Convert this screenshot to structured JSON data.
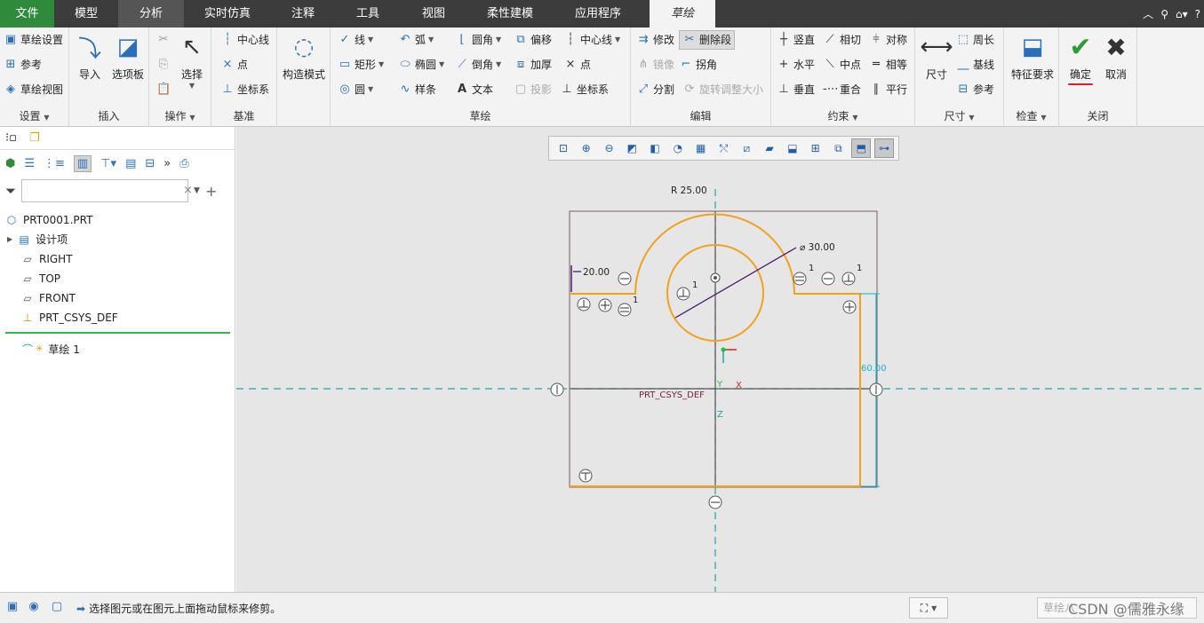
{
  "menu": {
    "tabs": [
      "文件",
      "模型",
      "分析",
      "实时仿真",
      "注释",
      "工具",
      "视图",
      "柔性建模",
      "应用程序",
      "草绘"
    ],
    "active": "草绘"
  },
  "ribbon": {
    "settings": {
      "label": "设置",
      "items": [
        "草绘设置",
        "参考",
        "草绘视图"
      ]
    },
    "insert": {
      "label": "插入",
      "items": [
        "导入",
        "选项板"
      ]
    },
    "ops": {
      "label": "操作",
      "select": "选择"
    },
    "datum": {
      "label": "基准",
      "items": [
        "中心线",
        "点",
        "坐标系"
      ]
    },
    "construct": {
      "label": "构造模式"
    },
    "sketch": {
      "label": "草绘",
      "items": [
        "线",
        "弧",
        "圆角",
        "偏移",
        "中心线",
        "矩形",
        "椭圆",
        "倒角",
        "加厚",
        "点",
        "圆",
        "样条",
        "文本",
        "投影",
        "坐标系"
      ]
    },
    "edit": {
      "label": "编辑",
      "items": [
        "修改",
        "删除段",
        "镜像",
        "拐角",
        "分割",
        "旋转调整大小"
      ]
    },
    "constrain": {
      "label": "约束",
      "items": [
        "竖直",
        "相切",
        "对称",
        "水平",
        "中点",
        "相等",
        "垂直",
        "重合",
        "平行"
      ]
    },
    "dimension": {
      "label": "尺寸",
      "items": [
        "尺寸",
        "周长",
        "基线",
        "参考"
      ]
    },
    "inspect": {
      "label": "检查",
      "items": [
        "特征要求"
      ]
    },
    "close": {
      "label": "关闭",
      "items": [
        "确定",
        "取消"
      ]
    }
  },
  "tree": {
    "part": "PRT0001.PRT",
    "items": [
      "设计项",
      "RIGHT",
      "TOP",
      "FRONT",
      "PRT_CSYS_DEF"
    ],
    "sketch": "草绘 1"
  },
  "sketch_labels": {
    "r": "R 25.00",
    "dia": "⌀ 30.00",
    "h": "20.00",
    "v": "60.00",
    "csys": "PRT_CSYS_DEF",
    "one": "1",
    "y": "Y",
    "x": "X",
    "z": "Z"
  },
  "status": {
    "message": "选择图元或在图元上面拖动鼠标来修剪。",
    "selection": "草绘八",
    "watermark": "CSDN @儒雅永缘"
  },
  "colors": {
    "accent_green": "#2f8a3c",
    "sketch_orange": "#f2a11d",
    "centerline_teal": "#1aa6a6",
    "dim_purple": "#4b1a72",
    "dim_cyan": "#16b3c9"
  }
}
